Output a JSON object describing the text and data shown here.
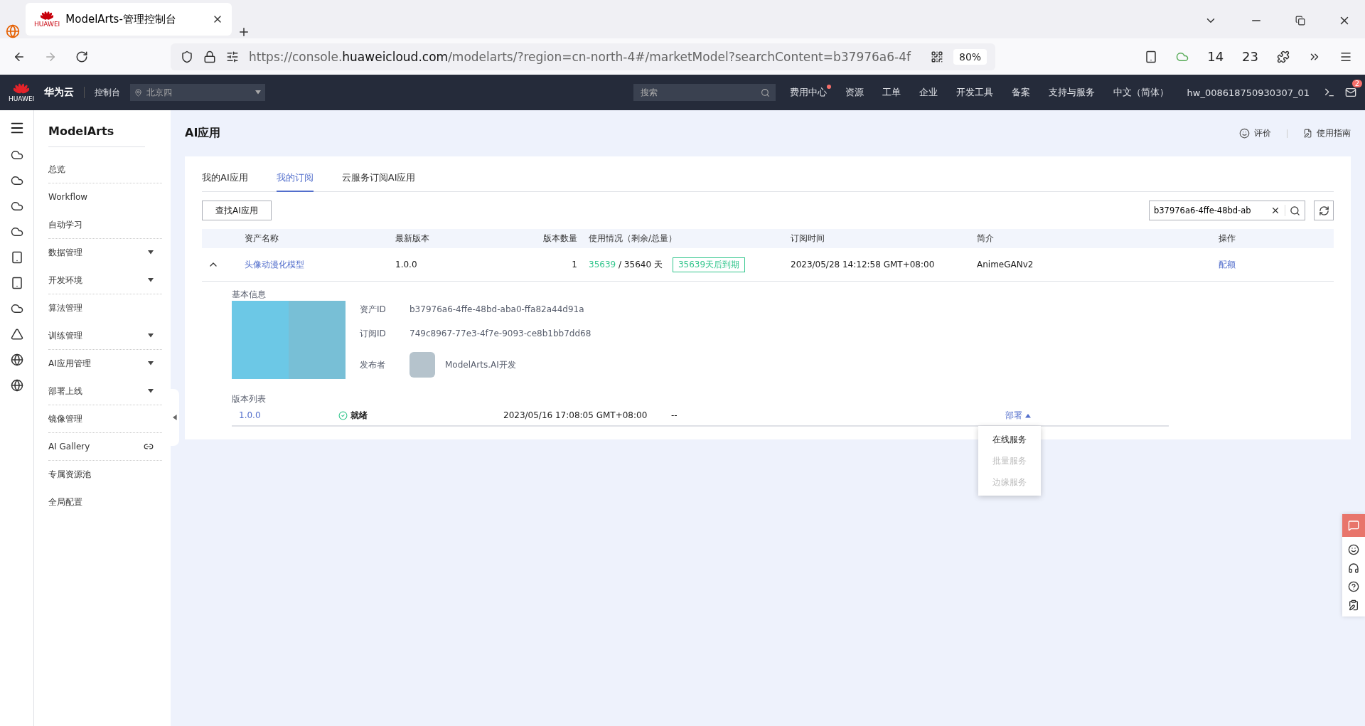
{
  "browser": {
    "tab_title": "ModelArts-管理控制台",
    "tab_logo_text": "HUAWEI",
    "url_prefix": "https://console.",
    "url_domain": "huaweicloud.com",
    "url_rest": "/modelarts/?region=cn-north-4#/marketModel?searchContent=b37976a6-4f",
    "zoom": "80%",
    "ext_count_1": "14",
    "ext_count_2": "23"
  },
  "header": {
    "logo_text": "HUAWEI",
    "brand": "华为云",
    "console": "控制台",
    "region": "北京四",
    "search_placeholder": "搜索",
    "nav": [
      {
        "label": "费用中心",
        "dot": true
      },
      {
        "label": "资源",
        "dot": false
      },
      {
        "label": "工单",
        "dot": false
      },
      {
        "label": "企业",
        "dot": false
      },
      {
        "label": "开发工具",
        "dot": false
      },
      {
        "label": "备案",
        "dot": false
      },
      {
        "label": "支持与服务",
        "dot": false
      },
      {
        "label": "中文（简体）",
        "dot": false
      },
      {
        "label": "hw_008618750930307_01",
        "dot": false
      }
    ],
    "mail_badge": "2"
  },
  "sidebar": {
    "title": "ModelArts",
    "items": [
      {
        "label": "总览",
        "kind": "link",
        "divider_after": true
      },
      {
        "label": "Workflow",
        "kind": "link",
        "divider_after": false
      },
      {
        "label": "自动学习",
        "kind": "link",
        "divider_after": true
      },
      {
        "label": "数据管理",
        "kind": "group",
        "divider_after": false
      },
      {
        "label": "开发环境",
        "kind": "group",
        "divider_after": true
      },
      {
        "label": "算法管理",
        "kind": "link",
        "divider_after": false
      },
      {
        "label": "训练管理",
        "kind": "group",
        "divider_after": true
      },
      {
        "label": "AI应用管理",
        "kind": "group",
        "divider_after": false
      },
      {
        "label": "部署上线",
        "kind": "group",
        "divider_after": true
      },
      {
        "label": "镜像管理",
        "kind": "link",
        "divider_after": true
      },
      {
        "label": "AI Gallery",
        "kind": "external",
        "divider_after": true
      },
      {
        "label": "专属资源池",
        "kind": "link",
        "divider_after": false
      },
      {
        "label": "全局配置",
        "kind": "link",
        "divider_after": false
      }
    ]
  },
  "page": {
    "title": "AI应用",
    "rate": "评价",
    "guide": "使用指南"
  },
  "tabs": [
    {
      "label": "我的AI应用",
      "selected": false
    },
    {
      "label": "我的订阅",
      "selected": true
    },
    {
      "label": "云服务订阅AI应用",
      "selected": false
    }
  ],
  "find_button": "查找AI应用",
  "search_value": "b37976a6-4ffe-48bd-ab",
  "table": {
    "columns": [
      "资产名称",
      "最新版本",
      "版本数量",
      "使用情况（剩余/总量）",
      "订阅时间",
      "简介",
      "操作"
    ],
    "rows": [
      {
        "expanded": true,
        "name": "头像动漫化模型",
        "version": "1.0.0",
        "count": "1",
        "remaining": "35639",
        "total": "/ 35640 天",
        "expiry": "35639天后到期",
        "time": "2023/05/28 14:12:58 GMT+08:00",
        "intro": "AnimeGANv2",
        "action": "配额",
        "details": {
          "section": "基本信息",
          "fields": [
            {
              "label": "资产ID",
              "value": "b37976a6-4ffe-48bd-aba0-ffa82a44d91a"
            },
            {
              "label": "订阅ID",
              "value": "749c8967-77e3-4f7e-9093-ce8b1bb7dd68"
            }
          ],
          "publisher_label": "发布者",
          "publisher": "ModelArts.AI开发",
          "versions_title": "版本列表",
          "versions": [
            {
              "version": "1.0.0",
              "status": "就绪",
              "time": "2023/05/16 17:08:05 GMT+08:00",
              "note": "--",
              "action": "部署",
              "menu_open": true
            }
          ]
        }
      }
    ]
  },
  "deploy_menu": [
    {
      "label": "在线服务",
      "disabled": false
    },
    {
      "label": "批量服务",
      "disabled": true
    },
    {
      "label": "边缘服务",
      "disabled": true
    }
  ]
}
